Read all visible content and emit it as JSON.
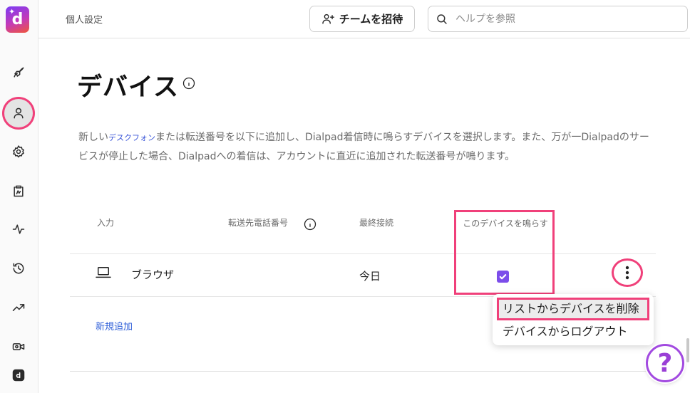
{
  "header": {
    "breadcrumb": "個人設定",
    "invite_label": "チームを招待",
    "search_placeholder": "ヘルプを参照"
  },
  "sidebar": {
    "items": [
      {
        "name": "rocket-icon"
      },
      {
        "name": "person-icon",
        "active": true
      },
      {
        "name": "gear-icon"
      },
      {
        "name": "clipboard-icon"
      },
      {
        "name": "activity-icon"
      },
      {
        "name": "history-icon"
      },
      {
        "name": "trending-icon"
      },
      {
        "name": "video-icon"
      },
      {
        "name": "dialpad-app-icon"
      }
    ]
  },
  "main": {
    "title": "デバイス",
    "description_prefix": "新しい",
    "description_link": "デスクフォン",
    "description_suffix": "または転送番号を以下に追加し、Dialpad着信時に鳴らすデバイスを選択します。また、万が一Dialpadのサービスが停止した場合、Dialpadへの着信は、アカウントに直近に追加された転送番号が鳴ります。",
    "table": {
      "headers": {
        "input": "入力",
        "forward_number": "転送先電話番号",
        "last_connected": "最終接続",
        "ring_device": "このデバイスを鳴らす"
      },
      "rows": [
        {
          "device": "ブラウザ",
          "forward_number": "",
          "last_connected": "今日",
          "ring": true
        }
      ]
    },
    "add_new": "新規追加"
  },
  "menu": {
    "items": [
      "リストからデバイスを削除",
      "デバイスからログアウト"
    ]
  },
  "help_fab": "?",
  "colors": {
    "highlight": "#f0407a",
    "checkbox": "#7c4dea",
    "link": "#2f5fd8",
    "help_ring": "#a24ae0"
  }
}
